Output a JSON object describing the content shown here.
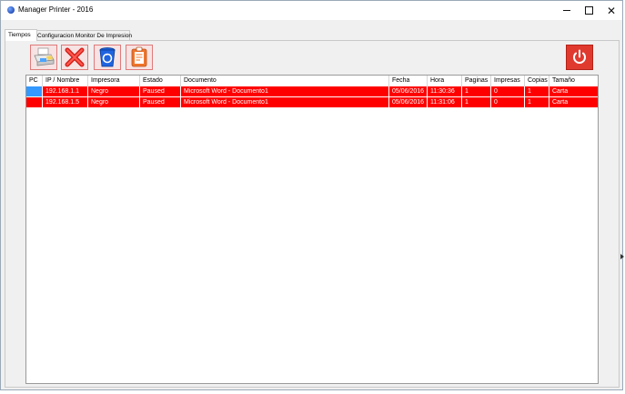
{
  "window": {
    "title": "Manager Printer - 2016"
  },
  "tabs": [
    {
      "label": "Tiempos"
    },
    {
      "label": "Configuracion Monitor De Impresion"
    }
  ],
  "toolbar": {
    "print_icon": "printer-icon",
    "cancel_icon": "red-x-icon",
    "recycle_icon": "recycle-bin-icon",
    "report_icon": "clipboard-report-icon",
    "power_icon": "power-icon"
  },
  "table": {
    "columns": [
      "PC",
      "IP / Nombre",
      "Impresora",
      "Estado",
      "Documento",
      "Fecha",
      "Hora",
      "Paginas",
      "Impresas",
      "Copias",
      "Tamaño"
    ],
    "rows": [
      {
        "pc": "",
        "ip": "192.168.1.1",
        "impresora": "Negro",
        "estado": "Paused",
        "documento": "Microsoft Word - Documento1",
        "fecha": "05/06/2016",
        "hora": "11:30:36",
        "paginas": "1",
        "impresas": "0",
        "copias": "1",
        "tamano": "Carta"
      },
      {
        "pc": "",
        "ip": "192.168.1.5",
        "impresora": "Negro",
        "estado": "Paused",
        "documento": "Microsoft Word - Documento1",
        "fecha": "05/06/2016",
        "hora": "11:31:06",
        "paginas": "1",
        "impresas": "0",
        "copias": "1",
        "tamano": "Carta"
      }
    ]
  },
  "colors": {
    "row_highlight": "#ff0000",
    "selected_cell": "#3399ff",
    "power_button": "#e03a2f"
  }
}
